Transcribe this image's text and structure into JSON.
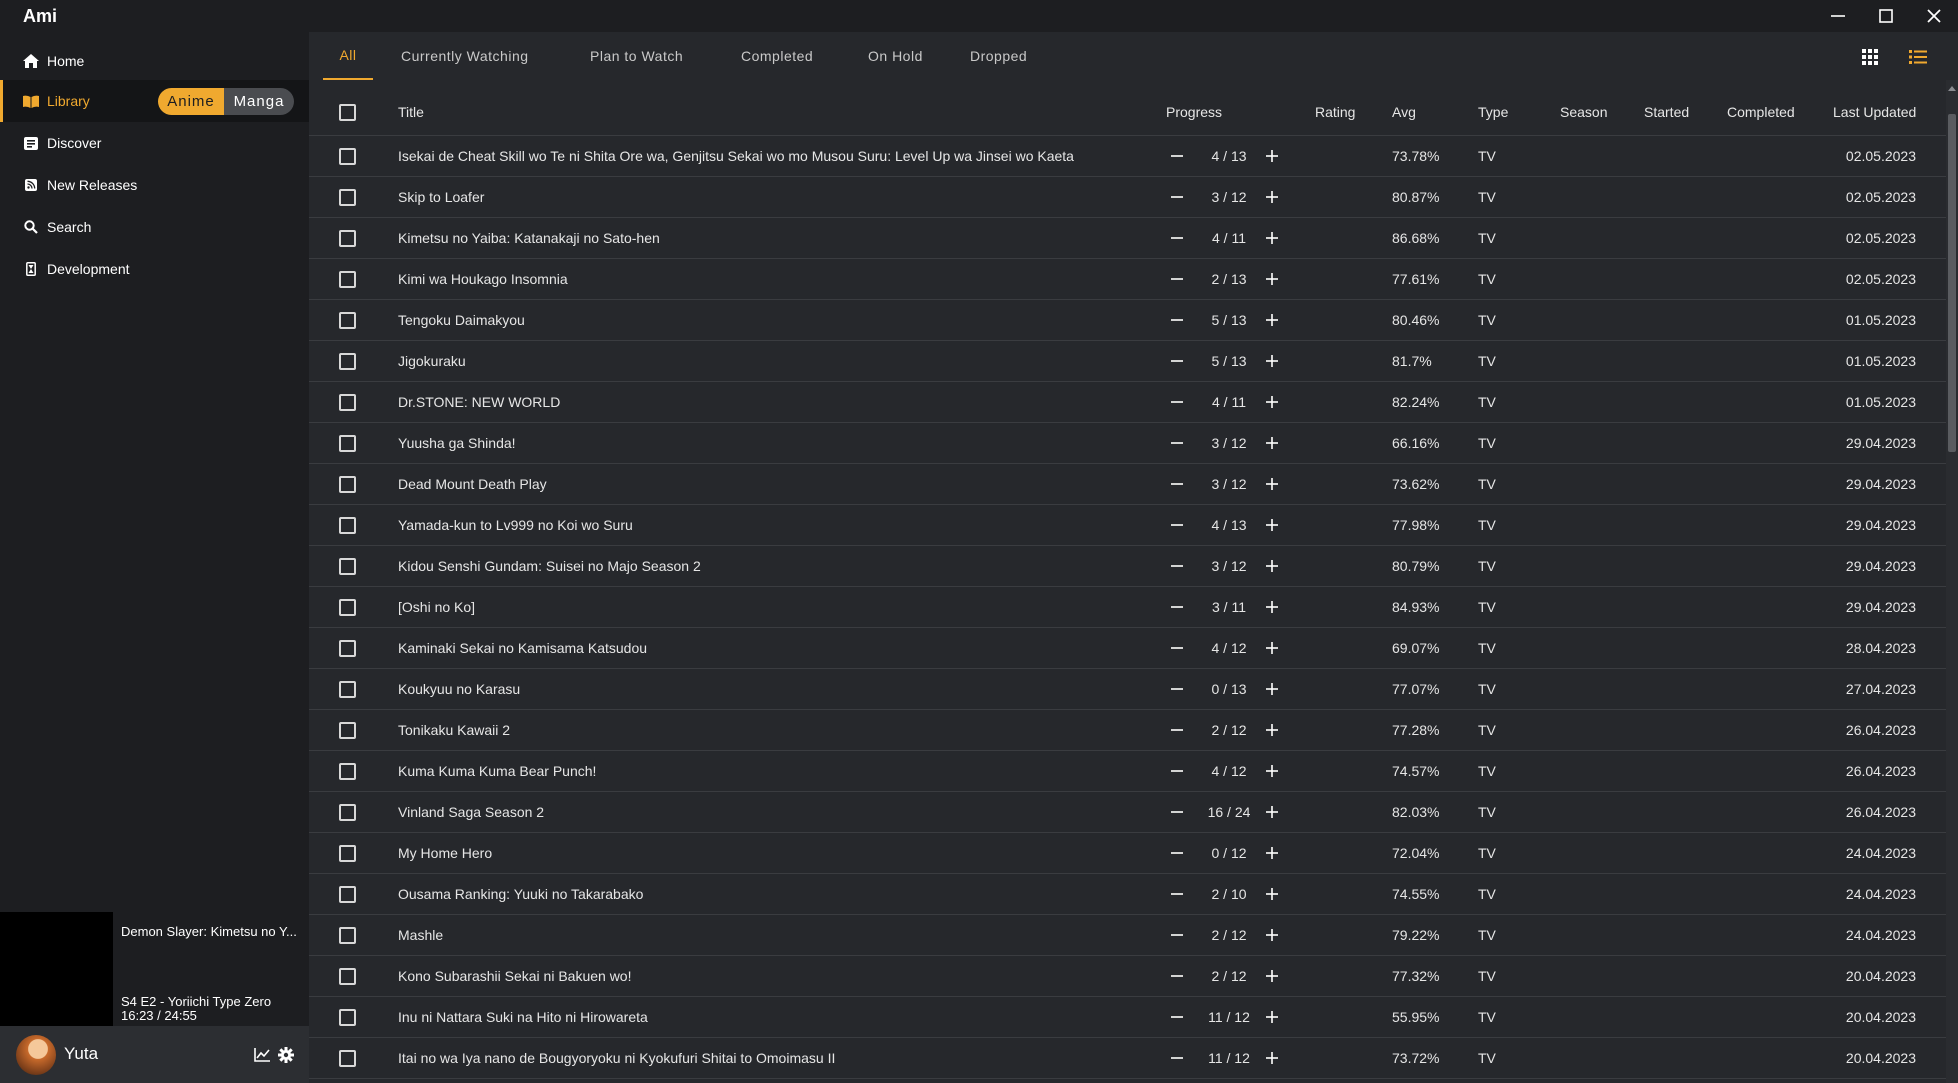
{
  "window": {
    "title": "Ami"
  },
  "sidebar": {
    "items": [
      {
        "label": "Home",
        "icon": "home-icon"
      },
      {
        "label": "Library",
        "icon": "book-icon"
      },
      {
        "label": "Discover",
        "icon": "discover-icon"
      },
      {
        "label": "New Releases",
        "icon": "rss-icon"
      },
      {
        "label": "Search",
        "icon": "search-icon"
      },
      {
        "label": "Development",
        "icon": "dev-icon"
      }
    ],
    "toggle": {
      "on": "Anime",
      "off": "Manga"
    },
    "player": {
      "title": "Demon Slayer: Kimetsu no Y...",
      "episode": "S4 E2 - Yoriichi Type Zero",
      "time": "16:23 / 24:55"
    },
    "user": {
      "name": "Yuta"
    }
  },
  "tabs": [
    "All",
    "Currently Watching",
    "Plan to Watch",
    "Completed",
    "On Hold",
    "Dropped"
  ],
  "columns": {
    "title": "Title",
    "progress": "Progress",
    "rating": "Rating",
    "avg": "Avg",
    "type": "Type",
    "season": "Season",
    "started": "Started",
    "completed": "Completed",
    "last_updated": "Last Updated"
  },
  "rows": [
    {
      "title": "Isekai de Cheat Skill wo Te ni Shita Ore wa, Genjitsu Sekai wo mo Musou Suru: Level Up wa Jinsei wo Kaeta",
      "progress": "4 / 13",
      "avg": "73.78%",
      "type": "TV",
      "updated": "02.05.2023"
    },
    {
      "title": "Skip to Loafer",
      "progress": "3 / 12",
      "avg": "80.87%",
      "type": "TV",
      "updated": "02.05.2023"
    },
    {
      "title": "Kimetsu no Yaiba: Katanakaji no Sato-hen",
      "progress": "4 / 11",
      "avg": "86.68%",
      "type": "TV",
      "updated": "02.05.2023"
    },
    {
      "title": "Kimi wa Houkago Insomnia",
      "progress": "2 / 13",
      "avg": "77.61%",
      "type": "TV",
      "updated": "02.05.2023"
    },
    {
      "title": "Tengoku Daimakyou",
      "progress": "5 / 13",
      "avg": "80.46%",
      "type": "TV",
      "updated": "01.05.2023"
    },
    {
      "title": "Jigokuraku",
      "progress": "5 / 13",
      "avg": "81.7%",
      "type": "TV",
      "updated": "01.05.2023"
    },
    {
      "title": "Dr.STONE: NEW WORLD",
      "progress": "4 / 11",
      "avg": "82.24%",
      "type": "TV",
      "updated": "01.05.2023"
    },
    {
      "title": "Yuusha ga Shinda!",
      "progress": "3 / 12",
      "avg": "66.16%",
      "type": "TV",
      "updated": "29.04.2023"
    },
    {
      "title": "Dead Mount Death Play",
      "progress": "3 / 12",
      "avg": "73.62%",
      "type": "TV",
      "updated": "29.04.2023"
    },
    {
      "title": "Yamada-kun to Lv999 no Koi wo Suru",
      "progress": "4 / 13",
      "avg": "77.98%",
      "type": "TV",
      "updated": "29.04.2023"
    },
    {
      "title": "Kidou Senshi Gundam: Suisei no Majo Season 2",
      "progress": "3 / 12",
      "avg": "80.79%",
      "type": "TV",
      "updated": "29.04.2023"
    },
    {
      "title": "[Oshi no Ko]",
      "progress": "3 / 11",
      "avg": "84.93%",
      "type": "TV",
      "updated": "29.04.2023"
    },
    {
      "title": "Kaminaki Sekai no Kamisama Katsudou",
      "progress": "4 / 12",
      "avg": "69.07%",
      "type": "TV",
      "updated": "28.04.2023"
    },
    {
      "title": "Koukyuu no Karasu",
      "progress": "0 / 13",
      "avg": "77.07%",
      "type": "TV",
      "updated": "27.04.2023"
    },
    {
      "title": "Tonikaku Kawaii 2",
      "progress": "2 / 12",
      "avg": "77.28%",
      "type": "TV",
      "updated": "26.04.2023"
    },
    {
      "title": "Kuma Kuma Kuma Bear Punch!",
      "progress": "4 / 12",
      "avg": "74.57%",
      "type": "TV",
      "updated": "26.04.2023"
    },
    {
      "title": "Vinland Saga Season 2",
      "progress": "16 / 24",
      "avg": "82.03%",
      "type": "TV",
      "updated": "26.04.2023"
    },
    {
      "title": "My Home Hero",
      "progress": "0 / 12",
      "avg": "72.04%",
      "type": "TV",
      "updated": "24.04.2023"
    },
    {
      "title": "Ousama Ranking: Yuuki no Takarabako",
      "progress": "2 / 10",
      "avg": "74.55%",
      "type": "TV",
      "updated": "24.04.2023"
    },
    {
      "title": "Mashle",
      "progress": "2 / 12",
      "avg": "79.22%",
      "type": "TV",
      "updated": "24.04.2023"
    },
    {
      "title": "Kono Subarashii Sekai ni Bakuen wo!",
      "progress": "2 / 12",
      "avg": "77.32%",
      "type": "TV",
      "updated": "20.04.2023"
    },
    {
      "title": "Inu ni Nattara Suki na Hito ni Hirowareta",
      "progress": "11 / 12",
      "avg": "55.95%",
      "type": "TV",
      "updated": "20.04.2023"
    },
    {
      "title": "Itai no wa Iya nano de Bougyoryoku ni Kyokufuri Shitai to Omoimasu II",
      "progress": "11 / 12",
      "avg": "73.72%",
      "type": "TV",
      "updated": "20.04.2023"
    }
  ],
  "colors": {
    "accent": "#f0a92f",
    "background": "#26282c",
    "sidebar": "#1d1e21"
  }
}
